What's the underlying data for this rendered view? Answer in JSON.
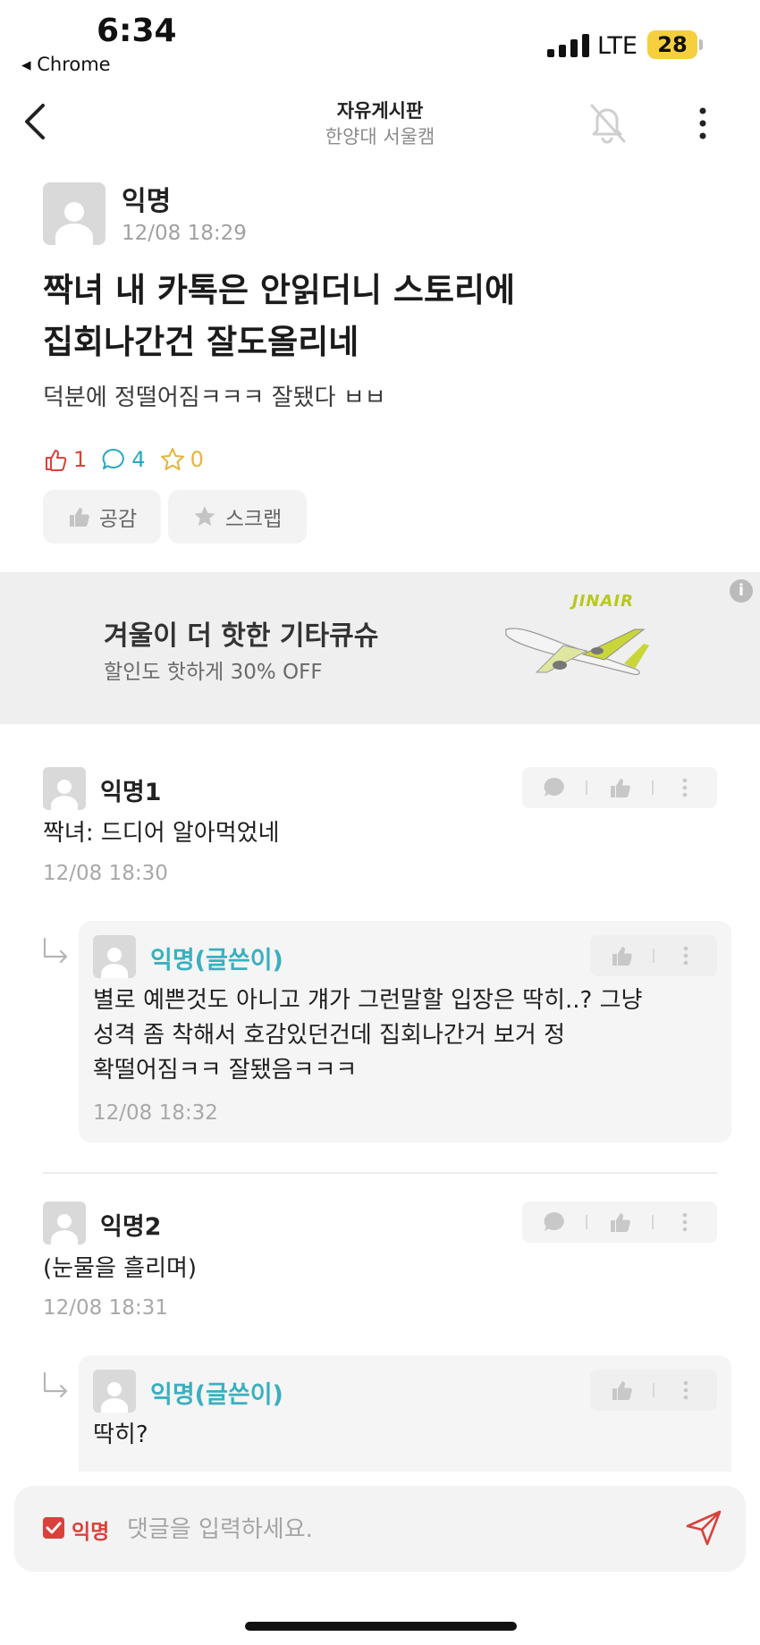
{
  "status_bar": {
    "time": "6:34",
    "back_app": "◂ Chrome",
    "network": "LTE",
    "battery": "28"
  },
  "nav": {
    "title": "자유게시판",
    "subtitle": "한양대 서울캠"
  },
  "post": {
    "author": "익명",
    "date": "12/08 18:29",
    "title_lines": [
      "짝녀 내 카톡은 안읽더니 스토리에",
      "집회나간건 잘도올리네"
    ],
    "body": "덕분에 정떨어짐ㅋㅋㅋ 잘됐다 ㅂㅂ",
    "likes": "1",
    "comments": "4",
    "scraps": "0",
    "like_button": "공감",
    "scrap_button": "스크랩"
  },
  "ad": {
    "title": "겨울이 더 핫한 기타큐슈",
    "subtitle": "할인도 핫하게 30% OFF",
    "brand": "JINAIR",
    "info": "i"
  },
  "comments": [
    {
      "author": "익명1",
      "text": "짝녀: 드디어 알아먹었네",
      "date": "12/08 18:30",
      "reply": {
        "author": "익명(글쓴이)",
        "lines": [
          "별로 예쁜것도 아니고 걔가 그런말할 입장은 딱히..? 그냥",
          "성격 좀 착해서 호감있던건데 집회나간거 보거 정",
          "확떨어짐ㅋㅋ 잘됐음ㅋㅋㅋ"
        ],
        "date": "12/08 18:32"
      }
    },
    {
      "author": "익명2",
      "text": "(눈물을 흘리며)",
      "date": "12/08 18:31",
      "reply": {
        "author": "익명(글쓴이)",
        "lines": [
          "딱히?"
        ]
      }
    }
  ],
  "input": {
    "anon_label": "익명",
    "placeholder": "댓글을 입력하세요."
  },
  "colors": {
    "accent_red": "#d9413b",
    "op_teal": "#39b0bf",
    "comment_teal": "#27a8bf",
    "scrap_yellow": "#e6b43b"
  }
}
